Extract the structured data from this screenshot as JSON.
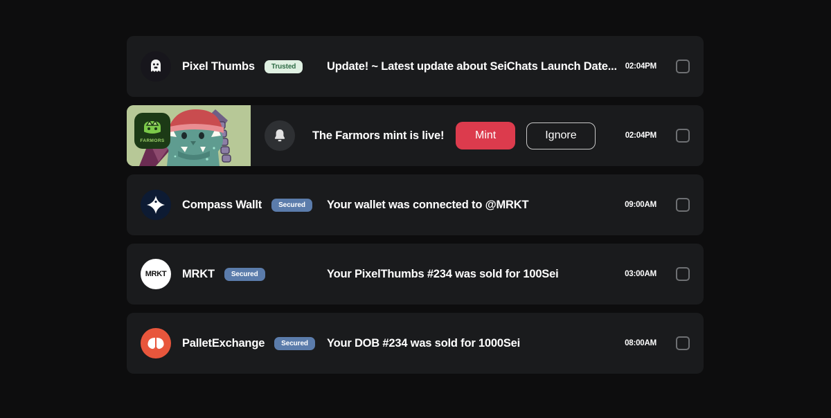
{
  "page": {
    "background_color": "#0d0d0e",
    "card_color": "#1a1b1d"
  },
  "colors": {
    "mint_button": "#dc3b4d",
    "trusted_badge_bg": "#dff0e2",
    "trusted_badge_text": "#2e6b45",
    "secured_badge_bg": "#5b7cab",
    "checkbox_border": "#6e7073"
  },
  "notifications": [
    {
      "id": "pixel-thumbs",
      "avatar_icon": "ghost-avatar-icon",
      "app_name": "Pixel Thumbs",
      "badge": "Trusted",
      "badge_type": "trusted",
      "message": "Update! ~ Latest update about SeiChats Launch Date...",
      "timestamp": "02:04PM",
      "checked": false
    },
    {
      "id": "farmors",
      "avatar_icon": "bell-icon",
      "cover_image": "farmors-cover-art",
      "cover_logo_text": "FARMORS",
      "app_name": "",
      "badge": "",
      "message": "The Farmors mint is live!",
      "primary_action": "Mint",
      "secondary_action": "Ignore",
      "timestamp": "02:04PM",
      "checked": false
    },
    {
      "id": "compass-wallet",
      "avatar_icon": "compass-star-icon",
      "app_name": "Compass Wallt",
      "badge": "Secured",
      "badge_type": "secured",
      "message": "Your wallet was connected to @MRKT",
      "timestamp": "09:00AM",
      "checked": false
    },
    {
      "id": "mrkt",
      "avatar_icon": "mrkt-logo-icon",
      "avatar_text": "MRKT",
      "app_name": "MRKT",
      "badge": "Secured",
      "badge_type": "secured",
      "message": "Your PixelThumbs #234 was sold for 100Sei",
      "timestamp": "03:00AM",
      "checked": false
    },
    {
      "id": "pallet-exchange",
      "avatar_icon": "pallet-logo-icon",
      "app_name": "PalletExchange",
      "badge": "Secured",
      "badge_type": "secured",
      "message": "Your  DOB #234 was sold for 1000Sei",
      "timestamp": "08:00AM",
      "checked": false
    }
  ]
}
